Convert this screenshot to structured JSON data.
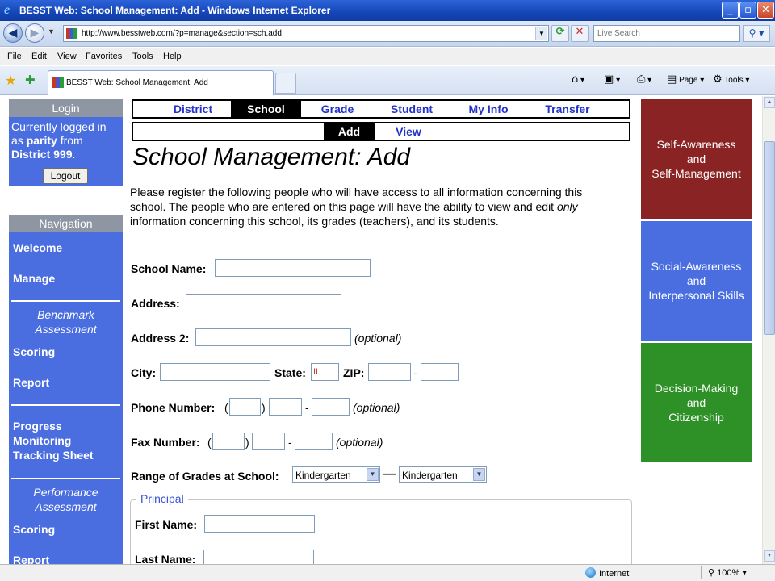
{
  "window": {
    "title": "BESST Web: School Management: Add - Windows Internet Explorer",
    "ie_icon": "ie-logo",
    "minimize": "_",
    "maximize": "▫",
    "close": "✕"
  },
  "address": {
    "url": "http://www.besstweb.com/?p=manage&section=sch.add",
    "search_placeholder": "Live Search"
  },
  "menu": [
    "File",
    "Edit",
    "View",
    "Favorites",
    "Tools",
    "Help"
  ],
  "tab": {
    "label": "BESST Web: School Management: Add"
  },
  "commands": {
    "page": "Page",
    "tools": "Tools"
  },
  "sidebar": {
    "login": {
      "header": "Login",
      "prefix": "Currently logged in as ",
      "user": "parity",
      "middle": " from ",
      "district": "District 999",
      "suffix": ".",
      "logout": "Logout"
    },
    "navigation": {
      "header": "Navigation",
      "welcome": "Welcome",
      "manage": "Manage",
      "benchmark": "Benchmark Assessment",
      "scoring1": "Scoring",
      "report1": "Report",
      "progress": "Progress Monitoring Tracking Sheet",
      "performance": "Performance Assessment",
      "scoring2": "Scoring",
      "report2": "Report"
    }
  },
  "topnav": [
    "District",
    "School",
    "Grade",
    "Student",
    "My Info",
    "Transfer"
  ],
  "subnav": [
    "Add",
    "View"
  ],
  "page": {
    "title": "School Management: Add",
    "intro_1": "Please register the following people who will have access to all information concerning this school. The people who are entered on this page will have the ability to view and edit ",
    "intro_em": "only",
    "intro_2": " information concerning this school, its grades (teachers), and its students."
  },
  "form": {
    "school_name_label": "School Name:",
    "address_label": "Address:",
    "address2_label": "Address 2:",
    "optional": "(optional)",
    "city_label": "City:",
    "state_label": "State:",
    "state_value": "IL",
    "zip_label": "ZIP:",
    "dash": "-",
    "phone_label": "Phone Number:",
    "fax_label": "Fax Number:",
    "paren_open": "(",
    "paren_close": ")",
    "grades_label": "Range of Grades at School:",
    "grade_from": "Kindergarten",
    "grade_to": "Kindergarten",
    "range_dash": "—",
    "principal_legend": "Principal",
    "first_name_label": "First Name:",
    "last_name_label": "Last Name:"
  },
  "panels": [
    "Self-Awareness and Self-Management",
    "Social-Awareness and Interpersonal Skills",
    "Decision-Making and Citizenship"
  ],
  "panel_lines": {
    "p1": [
      "Self-Awareness",
      "and",
      "Self-Management"
    ],
    "p2": [
      "Social-Awareness",
      "and",
      "Interpersonal Skills"
    ],
    "p3": [
      "Decision-Making",
      "and",
      "Citizenship"
    ]
  },
  "status": {
    "zone": "Internet",
    "zoom": "100%"
  },
  "colors": {
    "sidebar_blue": "#4a6ee0",
    "header_gray": "#8f96a3",
    "nav_link": "#2233c8",
    "panel_red": "#8a2323",
    "panel_green": "#2e9127"
  }
}
